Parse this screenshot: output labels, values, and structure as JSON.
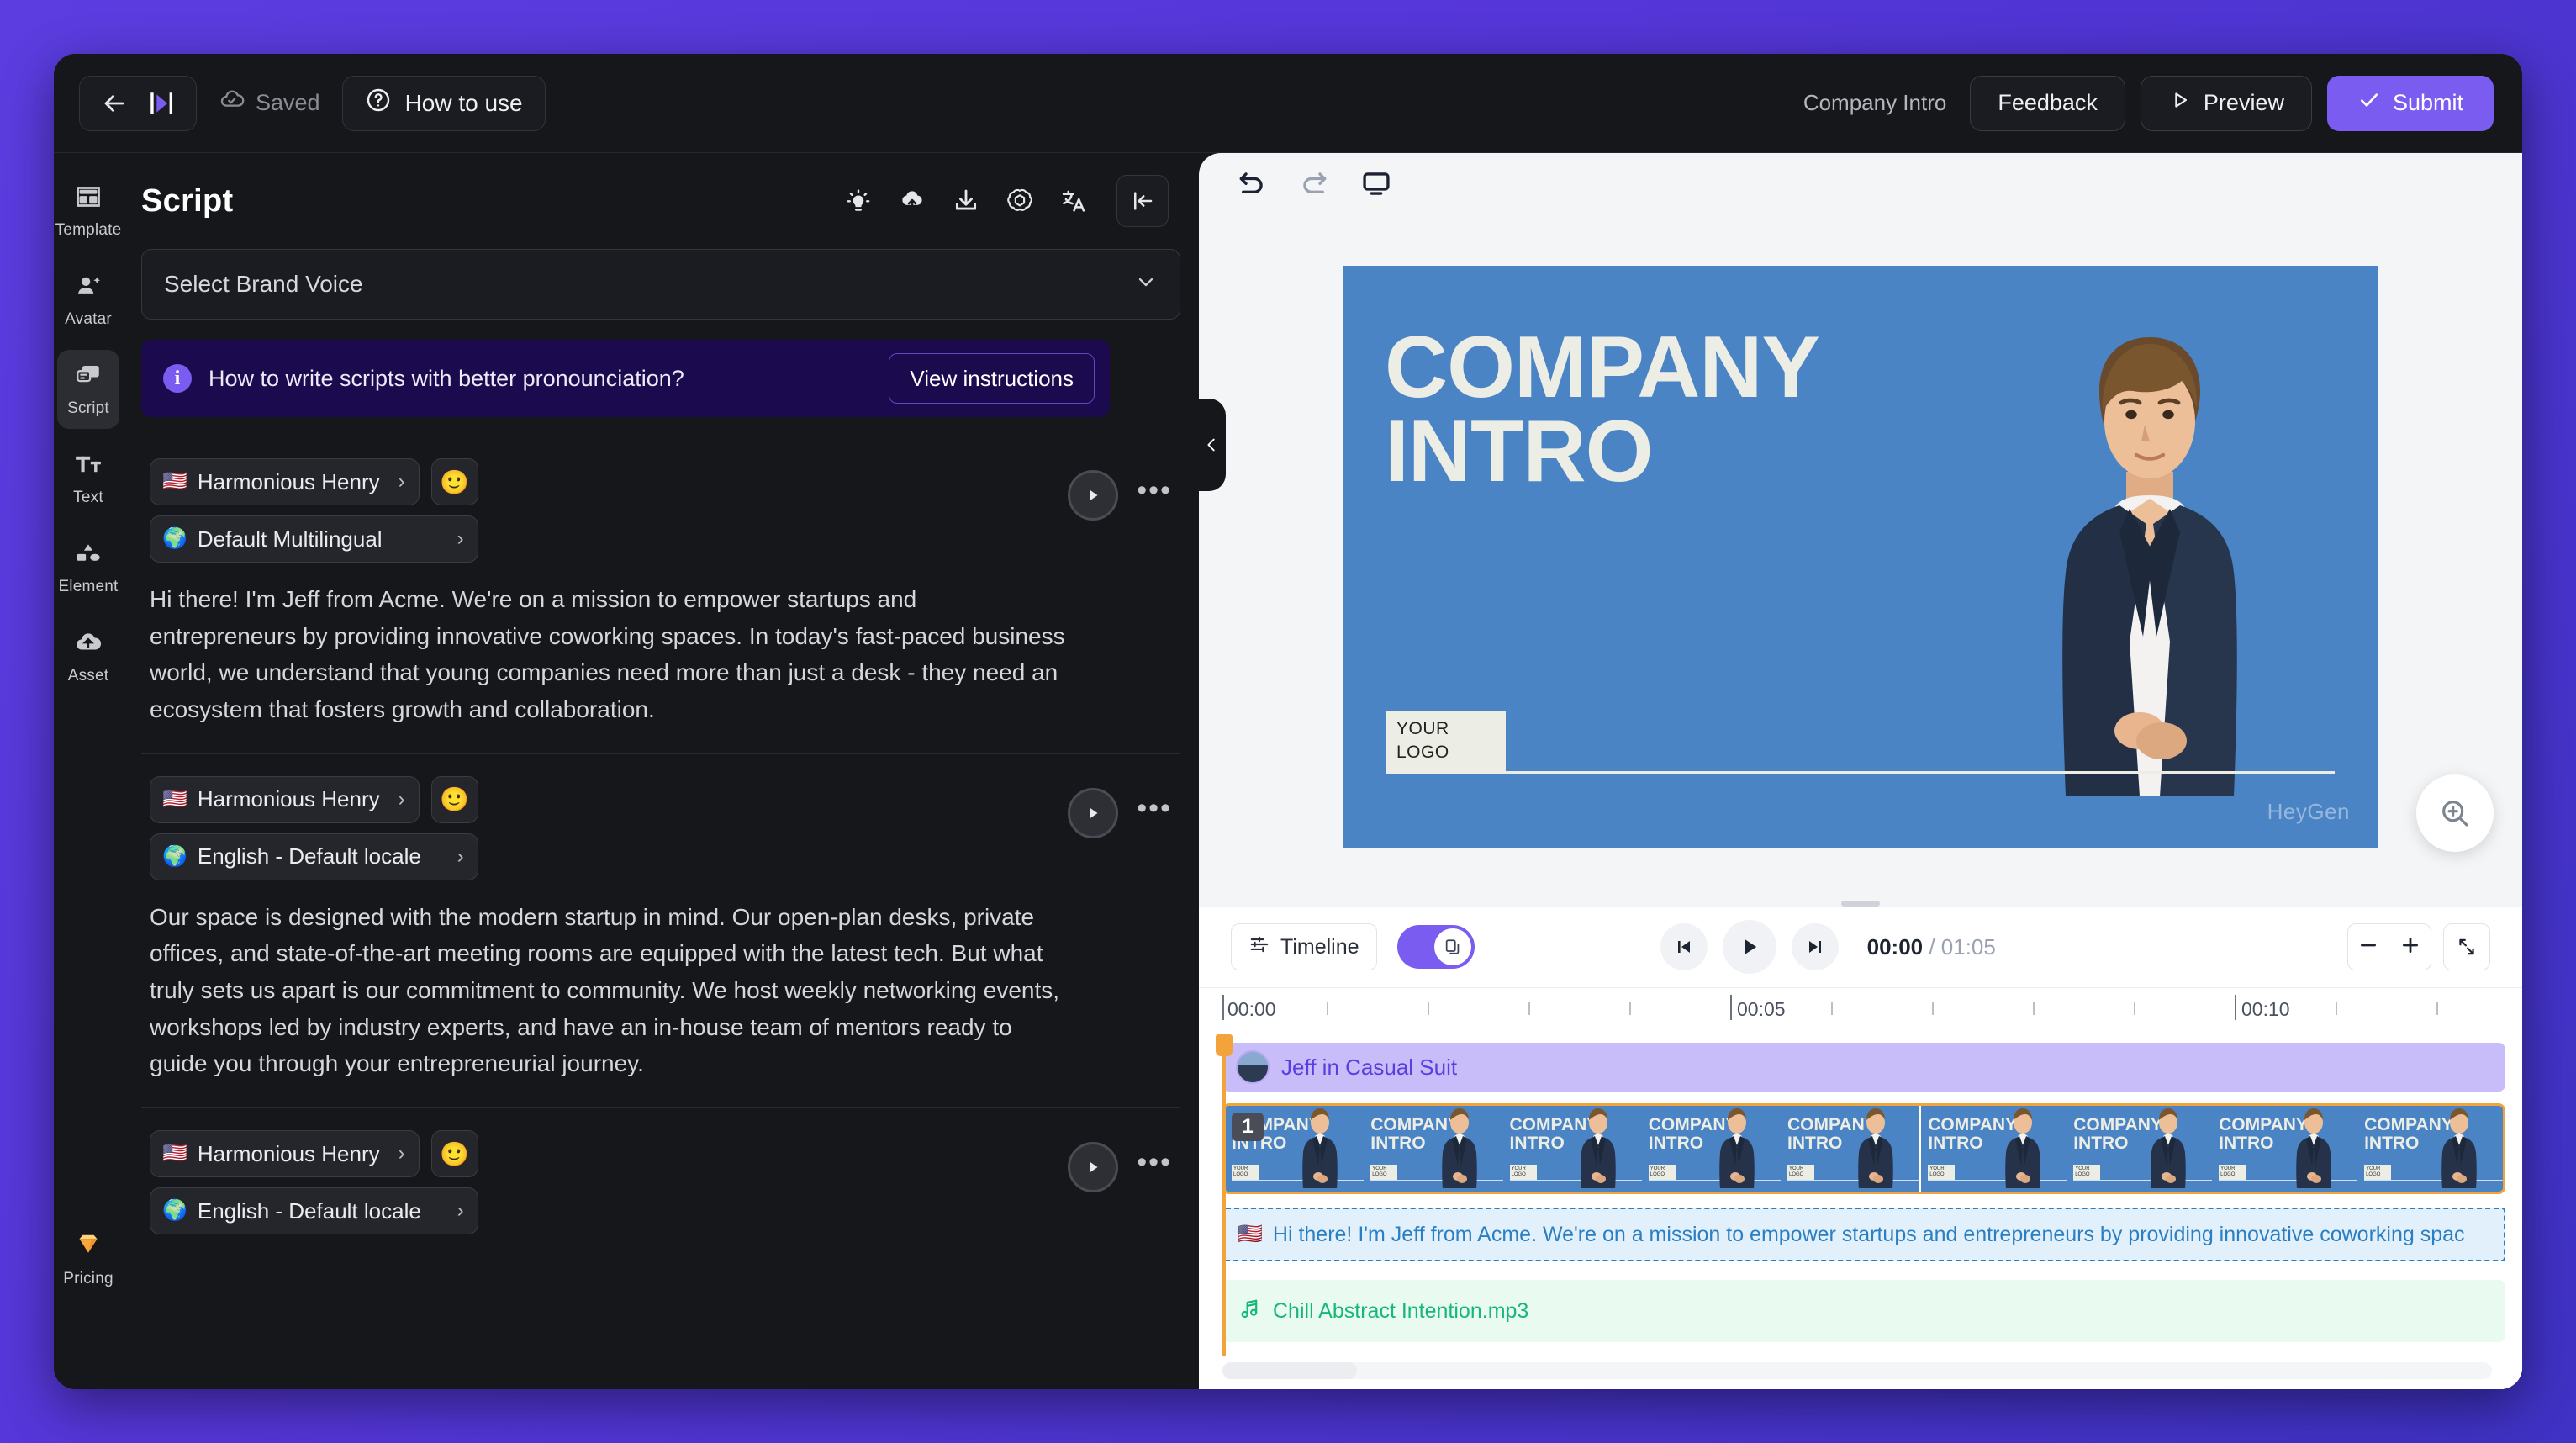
{
  "app": {
    "brand_accent": "#7b5cf0",
    "canvas_bg": "#4a84c4",
    "playhead_color": "#f2a33c"
  },
  "topbar": {
    "back_icon": "back-arrow-icon",
    "logo_icon": "heygen-logo-icon",
    "saved_label": "Saved",
    "saved_icon": "cloud-check-icon",
    "how_to_use_label": "How to use",
    "help_icon": "question-circle-icon",
    "project_name": "Company Intro",
    "feedback_label": "Feedback",
    "preview_label": "Preview",
    "preview_icon": "play-outline-icon",
    "submit_label": "Submit",
    "submit_icon": "check-icon"
  },
  "rail": {
    "items": [
      {
        "label": "Template",
        "icon": "template-icon",
        "active": false
      },
      {
        "label": "Avatar",
        "icon": "avatar-icon",
        "active": false
      },
      {
        "label": "Script",
        "icon": "script-icon",
        "active": true
      },
      {
        "label": "Text",
        "icon": "text-icon",
        "active": false
      },
      {
        "label": "Element",
        "icon": "element-icon",
        "active": false
      },
      {
        "label": "Asset",
        "icon": "asset-upload-icon",
        "active": false
      }
    ],
    "pricing": {
      "label": "Pricing",
      "icon": "diamond-icon"
    }
  },
  "script_panel": {
    "title": "Script",
    "tools": [
      {
        "name": "idea-lightbulb-icon"
      },
      {
        "name": "cloud-upload-icon"
      },
      {
        "name": "download-icon"
      },
      {
        "name": "openai-icon"
      },
      {
        "name": "translate-icon"
      },
      {
        "name": "collapse-panel-icon"
      }
    ],
    "brand_voice": {
      "label": "Select Brand Voice",
      "chevron": "chevron-down-icon"
    },
    "info_banner": {
      "icon": "info-icon",
      "text": "How to write scripts with better pronounciation?",
      "button_label": "View instructions"
    },
    "blocks": [
      {
        "voice": "Harmonious Henry",
        "voice_flag": "🇺🇸",
        "emoji": "🙂",
        "locale": "Default Multilingual",
        "locale_icon": "🌍",
        "text": "Hi there! I'm Jeff from Acme. We're on a mission to empower startups and entrepreneurs by providing innovative coworking spaces. In today's fast-paced business world, we understand that young companies need more than just a desk - they need an ecosystem that fosters growth and collaboration."
      },
      {
        "voice": "Harmonious Henry",
        "voice_flag": "🇺🇸",
        "emoji": "🙂",
        "locale": "English - Default locale",
        "locale_icon": "🌍",
        "text": "Our space is designed with the modern startup in mind. Our open-plan desks, private offices, and state-of-the-art meeting rooms are equipped with the latest tech. But what truly sets us apart is our commitment to community. We host weekly networking events, workshops led by industry experts, and have an in-house team of mentors ready to guide you through your entrepreneurial journey."
      },
      {
        "voice": "Harmonious Henry",
        "voice_flag": "🇺🇸",
        "emoji": "🙂",
        "locale": "English - Default locale",
        "locale_icon": "🌍",
        "text": ""
      }
    ],
    "block_play_icon": "play-icon",
    "block_more_icon": "more-options-icon"
  },
  "stage": {
    "toolbar": [
      {
        "name": "undo-icon"
      },
      {
        "name": "redo-icon"
      },
      {
        "name": "screen-icon"
      }
    ],
    "panel_toggle_icon": "chevron-left-icon",
    "zoom_fab_icon": "zoom-in-icon",
    "canvas": {
      "title_line1": "COMPANY",
      "title_line2": "INTRO",
      "logo_line1": "YOUR",
      "logo_line2": "LOGO",
      "watermark": "HeyGen"
    }
  },
  "timeline": {
    "timeline_label": "Timeline",
    "timeline_icon": "timeline-icon",
    "toggle_icon": "scene-toggle-icon",
    "toggle_on": true,
    "prev_icon": "skip-back-icon",
    "play_icon": "play-icon",
    "next_icon": "skip-forward-icon",
    "current_time": "00:00",
    "total_time": "/ 01:05",
    "zoom_out_icon": "minus-icon",
    "zoom_in_icon": "plus-icon",
    "fit_icon": "fit-screen-icon",
    "ruler_labels": [
      "00:00",
      "00:05",
      "00:10"
    ],
    "tracks": {
      "avatar": {
        "label": "Jeff in Casual Suit",
        "icon": "avatar-thumb-icon"
      },
      "scenes": {
        "badge": "1",
        "frame_title_line1": "COMPANY",
        "frame_title_line2": "INTRO",
        "frame_logo_line1": "YOUR",
        "frame_logo_line2": "LOGO",
        "frame_count": 9
      },
      "caption": {
        "flag": "🇺🇸",
        "text": "Hi there! I'm Jeff from Acme. We're on a mission to empower startups and entrepreneurs by providing innovative coworking spac"
      },
      "audio": {
        "label": "Chill Abstract Intention.mp3",
        "icon": "music-note-icon"
      }
    }
  }
}
